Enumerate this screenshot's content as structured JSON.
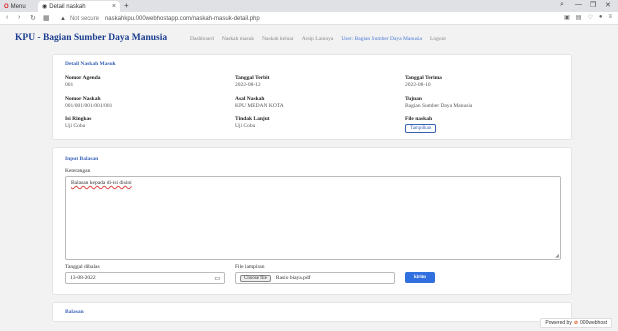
{
  "browser": {
    "menu_tab": "Menu",
    "active_tab": "Detail naskah",
    "tab_close": "×",
    "new_tab": "+",
    "not_secure": "Not secure",
    "url": "naskahkpu.000webhostapp.com/naskah-masuk-detail.php",
    "win_minimize": "—",
    "win_maximize": "❐",
    "win_close": "✕"
  },
  "navbar": {
    "brand": "KPU - Bagian Sumber Daya Manusia",
    "links": [
      "Dashboard",
      "Naskah masuk",
      "Naskah keluar",
      "Arsip Lainnya",
      "User: Bagian Sumber Daya Manusia",
      "Logout"
    ]
  },
  "detail": {
    "title": "Detail Naskah Masuk",
    "nomor_agenda_label": "Nomor Agenda",
    "nomor_agenda": "001",
    "tanggal_terbit_label": "Tanggal Terbit",
    "tanggal_terbit": "2022-08-12",
    "tanggal_terima_label": "Tanggal Terima",
    "tanggal_terima": "2022-08-10",
    "nomor_naskah_label": "Nomor Naskah",
    "nomor_naskah": "001/001/001/001/001",
    "asal_naskah_label": "Asal Naskah",
    "asal_naskah": "KPU MEDAN KOTA",
    "tujuan_label": "Tujuan",
    "tujuan": "Bagian Sumber Daya Manusia",
    "isi_ringkas_label": "Isi Ringkas",
    "isi_ringkas": "Uji Coba",
    "tindak_lanjut_label": "Tindak Lanjut",
    "tindak_lanjut": "Uji Coba",
    "file_naskah_label": "File naskah",
    "file_naskah_button": "Tampilkan"
  },
  "input_balasan": {
    "title": "Input Balasan",
    "keterangan_label": "Keterangan",
    "keterangan_value": "Balasan kepada di-isi disini",
    "tanggal_label": "Tanggal dibalas",
    "tanggal_value": "13-08-2022",
    "file_label": "File lampiran",
    "choose_file": "Choose file",
    "file_name": "Rasio biaya.pdf",
    "submit": "kirim"
  },
  "balasan": {
    "title": "Balasan"
  },
  "footer": {
    "powered": "Powered by",
    "host": "000webhost"
  }
}
